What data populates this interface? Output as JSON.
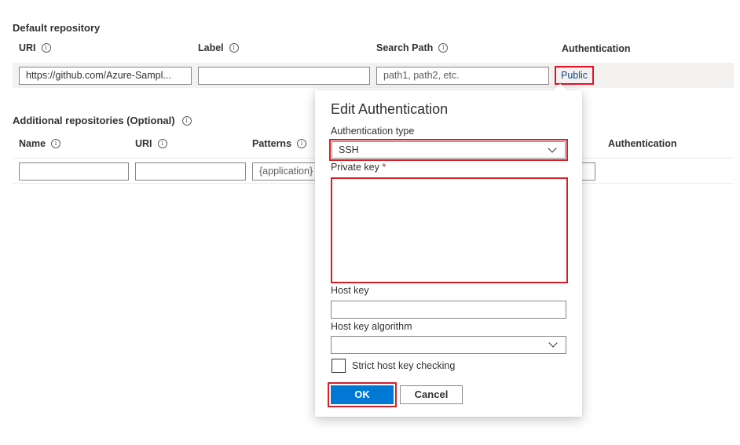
{
  "default_repo": {
    "title": "Default repository",
    "columns": {
      "uri": "URI",
      "label": "Label",
      "search_path": "Search Path",
      "authentication": "Authentication"
    },
    "uri_value": "https://github.com/Azure-Sampl...",
    "label_value": "",
    "search_path_placeholder": "path1, path2, etc.",
    "auth_link": "Public"
  },
  "additional_repos": {
    "title": "Additional repositories (Optional)",
    "columns": {
      "name": "Name",
      "uri": "URI",
      "patterns": "Patterns",
      "authentication": "Authentication"
    },
    "patterns_placeholder": "{application}"
  },
  "dialog": {
    "title": "Edit Authentication",
    "auth_type_label": "Authentication type",
    "auth_type_value": "SSH",
    "private_key_label": "Private key",
    "required_marker": "*",
    "host_key_label": "Host key",
    "host_key_algorithm_label": "Host key algorithm",
    "strict_checking_label": "Strict host key checking",
    "ok_label": "OK",
    "cancel_label": "Cancel"
  },
  "icons": {
    "info": "info-icon",
    "dropdown": "chevron-down-icon"
  },
  "colors": {
    "highlight": "#d61e2a",
    "primary": "#0078d4",
    "link": "#0f4a84"
  }
}
